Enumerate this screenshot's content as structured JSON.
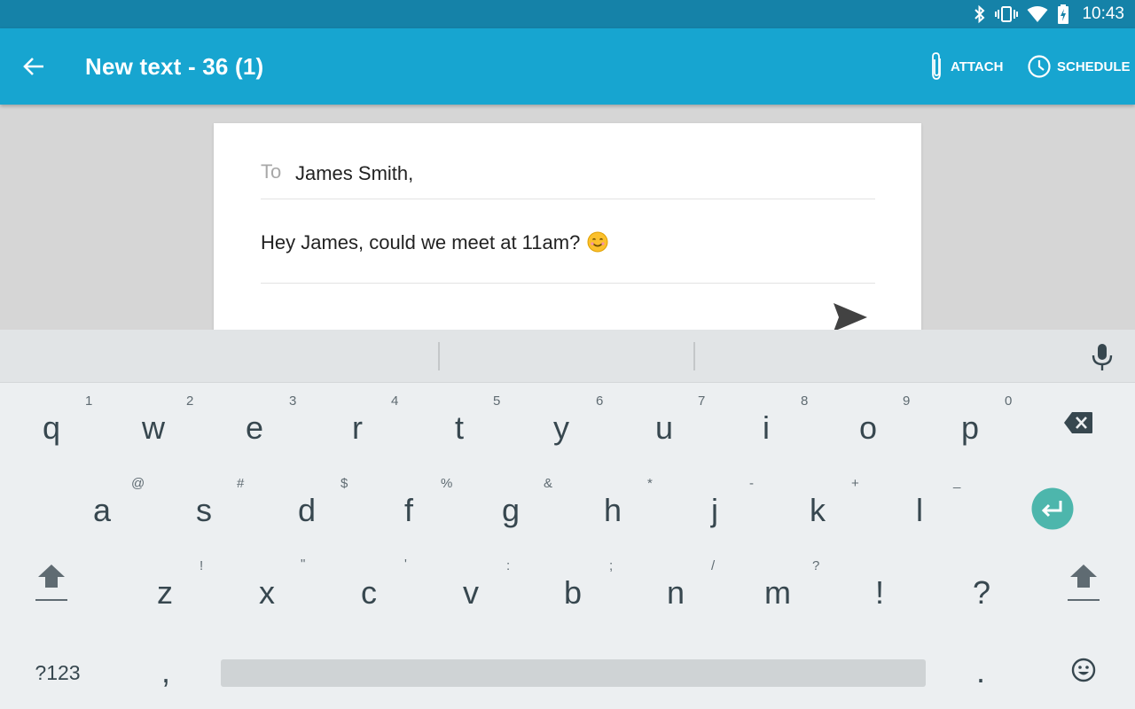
{
  "status_bar": {
    "time": "10:43",
    "icons": [
      "bluetooth-icon",
      "vibrate-icon",
      "wifi-icon",
      "battery-charging-icon"
    ]
  },
  "app_bar": {
    "title": "New text - 36 (1)",
    "back_icon": "arrow-back-icon",
    "attach_label": "ATTACH",
    "schedule_label": "SCHEDULE"
  },
  "compose": {
    "to_label": "To",
    "recipient": "James Smith,",
    "message": "Hey James, could we meet at 11am?",
    "emoji": "smiling-face-emoji"
  },
  "keyboard": {
    "row1": [
      {
        "key": "q",
        "hint": "1"
      },
      {
        "key": "w",
        "hint": "2"
      },
      {
        "key": "e",
        "hint": "3"
      },
      {
        "key": "r",
        "hint": "4"
      },
      {
        "key": "t",
        "hint": "5"
      },
      {
        "key": "y",
        "hint": "6"
      },
      {
        "key": "u",
        "hint": "7"
      },
      {
        "key": "i",
        "hint": "8"
      },
      {
        "key": "o",
        "hint": "9"
      },
      {
        "key": "p",
        "hint": "0"
      }
    ],
    "row2": [
      {
        "key": "a",
        "hint": "@"
      },
      {
        "key": "s",
        "hint": "#"
      },
      {
        "key": "d",
        "hint": "$"
      },
      {
        "key": "f",
        "hint": "%"
      },
      {
        "key": "g",
        "hint": "&"
      },
      {
        "key": "h",
        "hint": "*"
      },
      {
        "key": "j",
        "hint": "-"
      },
      {
        "key": "k",
        "hint": "+"
      },
      {
        "key": "l",
        "hint": "_"
      }
    ],
    "row3": [
      {
        "key": "z",
        "hint": "!"
      },
      {
        "key": "x",
        "hint": "\""
      },
      {
        "key": "c",
        "hint": "'"
      },
      {
        "key": "v",
        "hint": ":"
      },
      {
        "key": "b",
        "hint": ";"
      },
      {
        "key": "n",
        "hint": "/"
      },
      {
        "key": "m",
        "hint": "?"
      },
      {
        "key": "!",
        "hint": ""
      },
      {
        "key": "?",
        "hint": ""
      }
    ],
    "symbols_label": "?123",
    "comma": ",",
    "period": ".",
    "enter_color": "#4db6ac"
  }
}
